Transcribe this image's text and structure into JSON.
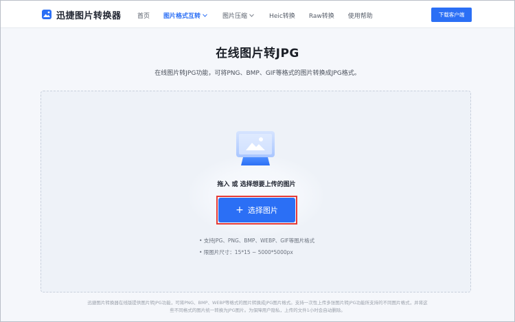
{
  "header": {
    "app_name": "迅捷图片转换器",
    "logo_icon": "image-icon",
    "nav": [
      {
        "label": "首页",
        "active": false,
        "dropdown": false
      },
      {
        "label": "图片格式互转",
        "active": true,
        "dropdown": true
      },
      {
        "label": "图片压缩",
        "active": false,
        "dropdown": true
      },
      {
        "label": "Heic转换",
        "active": false,
        "dropdown": false
      },
      {
        "label": "Raw转换",
        "active": false,
        "dropdown": false
      },
      {
        "label": "使用帮助",
        "active": false,
        "dropdown": false
      }
    ],
    "download_label": "下载客户端"
  },
  "main": {
    "title": "在线图片转JPG",
    "subtitle": "在线图片转JPG功能，可将PNG、BMP、GIF等格式的图片转换成JPG格式。",
    "upload": {
      "drop_text": "拖入 或 选择想要上传的图片",
      "select_label": "选择图片",
      "select_icon": "plus-icon",
      "notes": [
        "• 支持JPG、PNG、BMP、WEBP、GIF等图片格式",
        "• 限图片尺寸：15*15 ~ 5000*5000px"
      ]
    },
    "footer_lines": [
      "迅捷图片转换器在线版提供图片转JPG功能，可将PNG、BMP、WEBP等格式的图片转换成JPG图片格式。支持一次性上传多张图片转JPG功能所支持的不同图片格式，并将这",
      "些不同格式的图片统一转换为JPG图片。为保障用户隐私，上传的文件1小时会自动删除。"
    ]
  },
  "colors": {
    "accent": "#2b6ff5",
    "highlight_outline": "#e53935",
    "page_bg": "#f5f7fb"
  }
}
